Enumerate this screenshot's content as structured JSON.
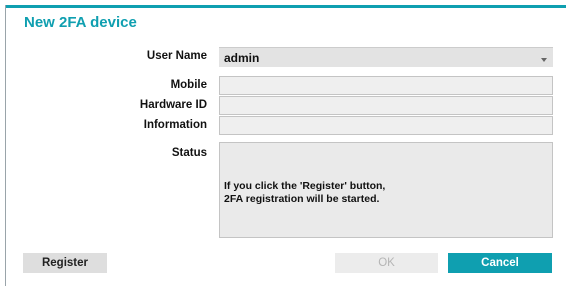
{
  "dialog": {
    "title": "New 2FA device"
  },
  "form": {
    "user_name_label": "User Name",
    "user_name_value": "admin",
    "mobile_label": "Mobile",
    "mobile_value": "",
    "hardware_id_label": "Hardware ID",
    "hardware_id_value": "",
    "information_label": "Information",
    "information_value": "",
    "status_label": "Status",
    "status_line1": "If you click the 'Register' button,",
    "status_line2": "2FA registration will be started."
  },
  "buttons": {
    "register": "Register",
    "ok": "OK",
    "cancel": "Cancel"
  },
  "colors": {
    "accent": "#0f9fb0",
    "field_bg": "#efefef",
    "disabled_text": "#b5b5b5"
  },
  "icons": {
    "dropdown": "chevron-down-icon"
  }
}
